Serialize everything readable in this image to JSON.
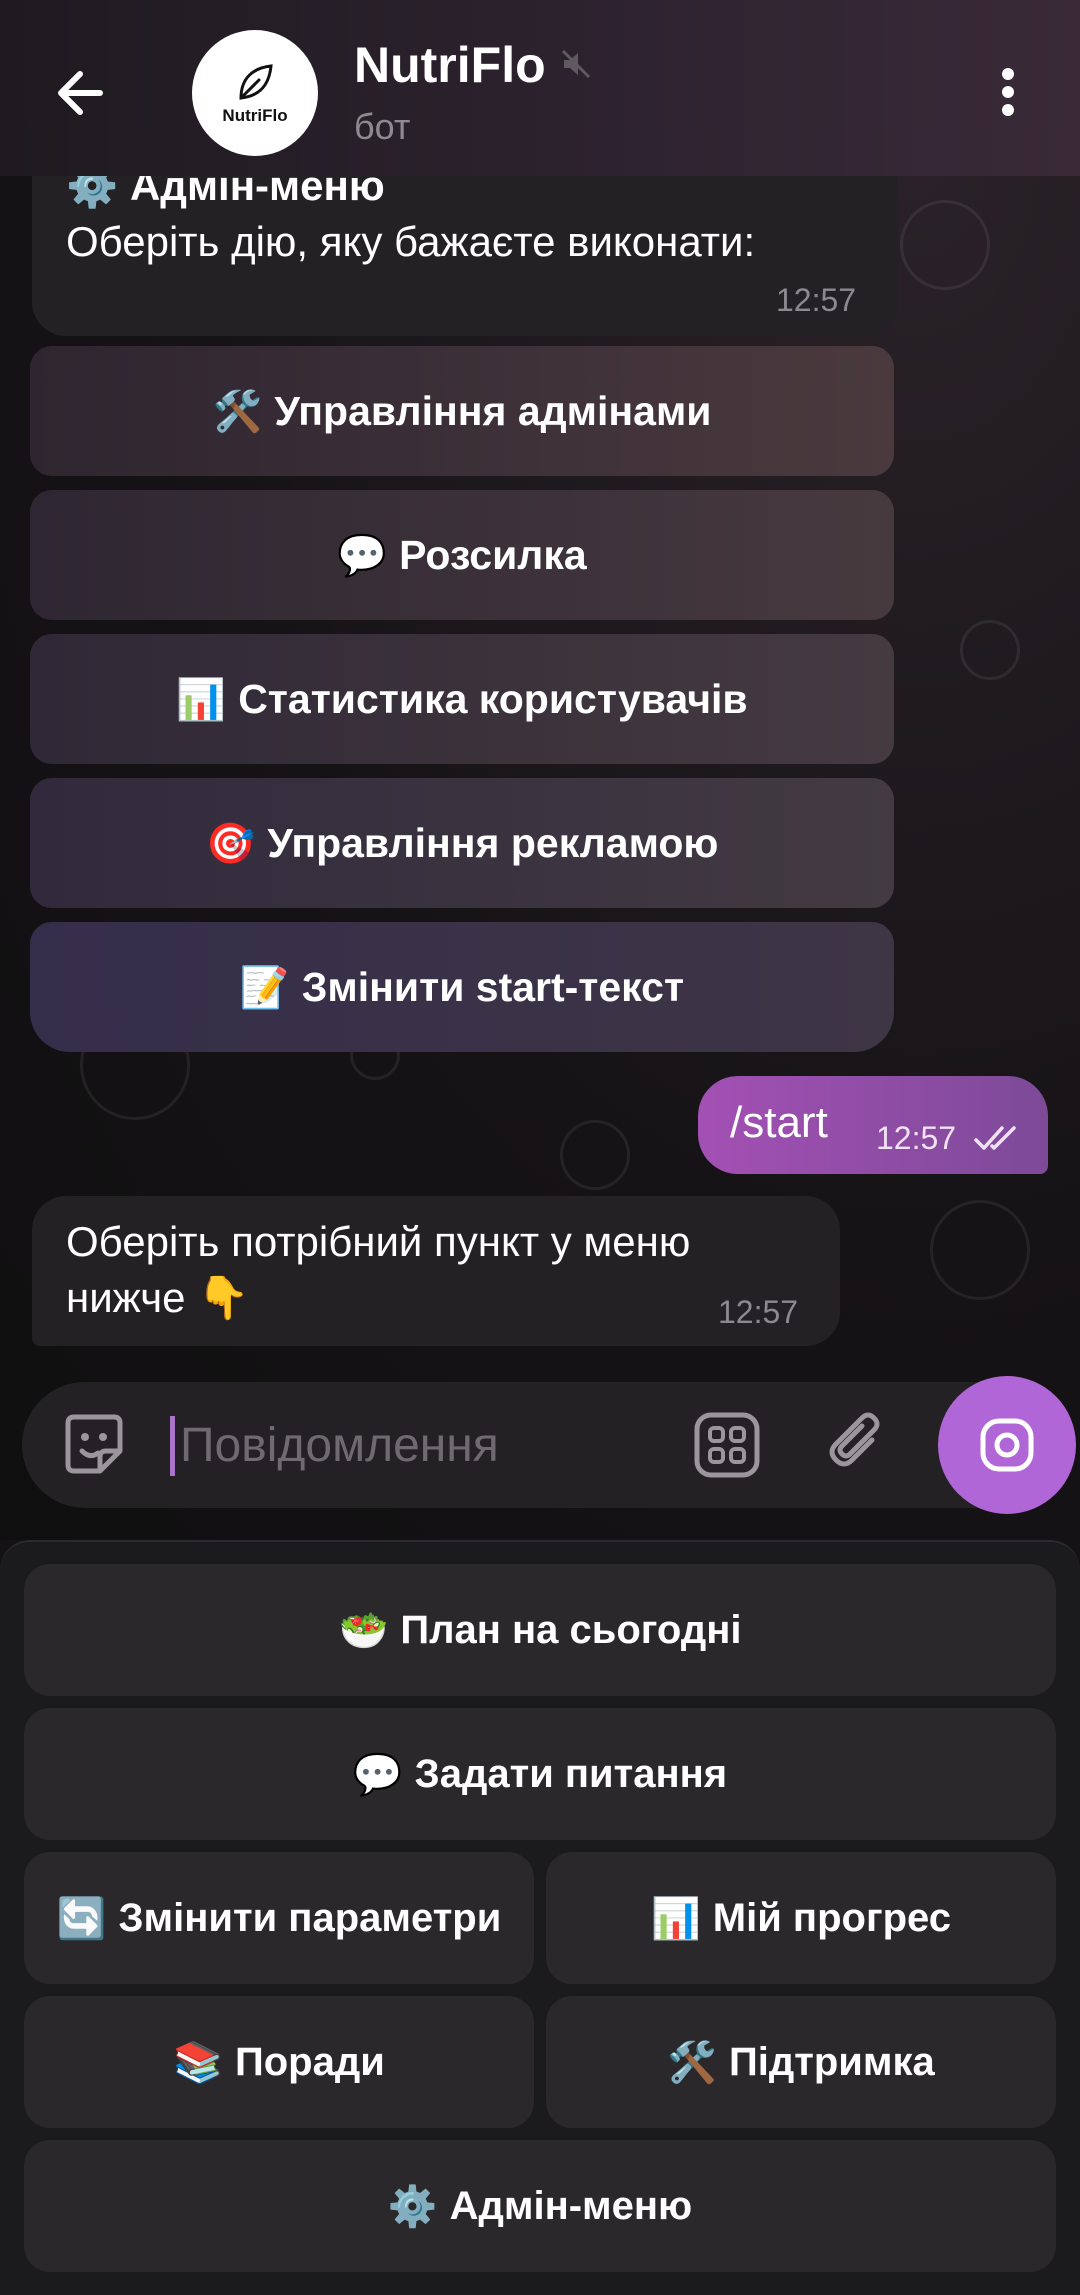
{
  "header": {
    "title": "NutriFlo",
    "subtitle": "бот",
    "avatar_text": "NutriFlo"
  },
  "messages": [
    {
      "title": "⚙️ Адмін-меню",
      "text": "Оберіть дію, яку бажаєте виконати:",
      "time": "12:57",
      "inline_buttons": [
        {
          "emoji": "🛠️",
          "label": "Управління адмінами"
        },
        {
          "emoji": "💬",
          "label": "Розсилка"
        },
        {
          "emoji": "📊",
          "label": "Статистика користувачів"
        },
        {
          "emoji": "🎯",
          "label": "Управління рекламою"
        },
        {
          "emoji": "📝",
          "label": "Змінити start-текст"
        }
      ]
    },
    {
      "text": "/start",
      "time": "12:57"
    },
    {
      "text": "Оберіть потрібний пункт у меню нижче 👇",
      "time": "12:57"
    }
  ],
  "input": {
    "placeholder": "Повідомлення"
  },
  "keyboard": [
    {
      "emoji": "🥗",
      "label": "План на сьогодні"
    },
    {
      "emoji": "💬",
      "label": "Задати питання"
    },
    {
      "emoji": "🔄",
      "label": "Змінити параметри"
    },
    {
      "emoji": "📊",
      "label": "Мій прогрес"
    },
    {
      "emoji": "📚",
      "label": "Поради"
    },
    {
      "emoji": "🛠️",
      "label": "Підтримка"
    },
    {
      "emoji": "⚙️",
      "label": "Адмін-меню"
    }
  ],
  "colors": {
    "accent": "#b066d6",
    "outgoing_bubble": "#a350b4",
    "incoming_bubble": "#232124"
  }
}
